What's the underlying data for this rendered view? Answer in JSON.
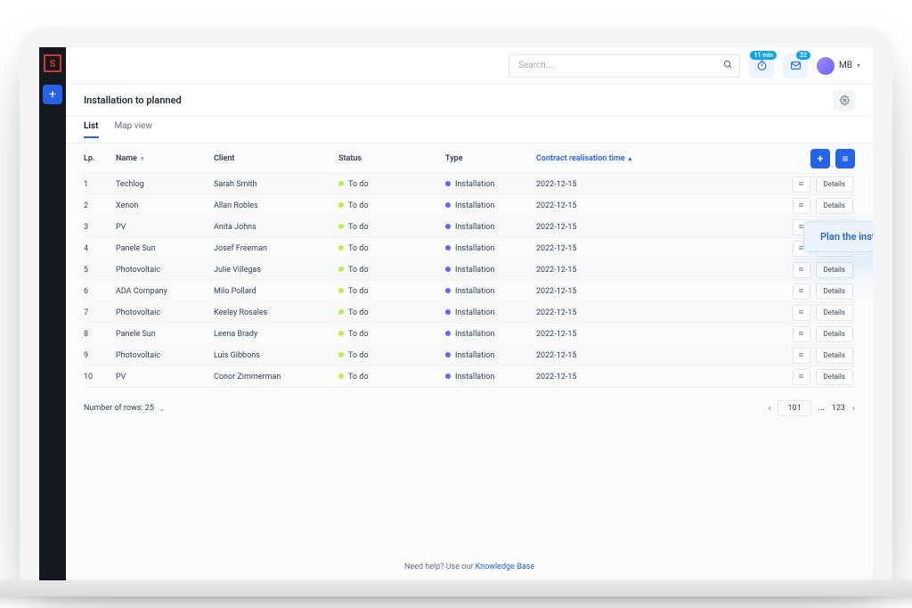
{
  "search": {
    "placeholder": "Search..."
  },
  "topbar": {
    "user": "MB",
    "badge1": "11 min",
    "badge2": "32"
  },
  "page": {
    "title": "Installation to planned"
  },
  "tabs": [
    "List",
    "Map view"
  ],
  "columns": {
    "lp": "Lp.",
    "name": "Name",
    "client": "Client",
    "status": "Status",
    "type": "Type",
    "contract": "Contract realisation time"
  },
  "status_label": "To do",
  "type_label": "Installation",
  "details_label": "Details",
  "rows": [
    {
      "lp": "1",
      "name": "Techlog",
      "client": "Sarah Smith",
      "date": "2022-12-15"
    },
    {
      "lp": "2",
      "name": "Xenon",
      "client": "Allan Robles",
      "date": "2022-12-15"
    },
    {
      "lp": "3",
      "name": "PV",
      "client": "Anita Johns",
      "date": "2022-12-15"
    },
    {
      "lp": "4",
      "name": "Panele Sun",
      "client": "Josef Freeman",
      "date": "2022-12-15"
    },
    {
      "lp": "5",
      "name": "Photovoltaic",
      "client": "Julie Villegas",
      "date": "2022-12-15"
    },
    {
      "lp": "6",
      "name": "ADA Company",
      "client": "Milo Pollard",
      "date": "2022-12-15"
    },
    {
      "lp": "7",
      "name": "Photovoltaic",
      "client": "Keeley Rosales",
      "date": "2022-12-15"
    },
    {
      "lp": "8",
      "name": "Panele Sun",
      "client": "Leena Brady",
      "date": "2022-12-15"
    },
    {
      "lp": "9",
      "name": "Photovoltaic",
      "client": "Luis Gibbons",
      "date": "2022-12-15"
    },
    {
      "lp": "10",
      "name": "PV",
      "client": "Conor Zimmerman",
      "date": "2022-12-15"
    }
  ],
  "footer": {
    "rows_label": "Number of rows: 25",
    "current_page": "101",
    "last_page": "123",
    "ellipsis": "..."
  },
  "help": {
    "prefix": "Need help? Use our ",
    "link": "Knowledge Base"
  },
  "tooltip": "Plan the installation"
}
